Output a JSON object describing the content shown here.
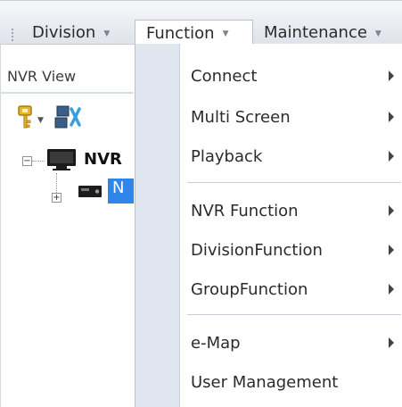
{
  "menubar": {
    "items": [
      {
        "label": "Division"
      },
      {
        "label": "Function"
      },
      {
        "label": "Maintenance"
      }
    ]
  },
  "panel": {
    "title": "NVR View",
    "tree": {
      "root_label": "NVR",
      "child_label": "N"
    }
  },
  "dropdown": {
    "items": [
      {
        "label": "Connect",
        "has_submenu": true
      },
      {
        "label": "Multi Screen",
        "has_submenu": true
      },
      {
        "label": "Playback",
        "has_submenu": true
      },
      {
        "label": "NVR Function",
        "has_submenu": true
      },
      {
        "label": "DivisionFunction",
        "has_submenu": true
      },
      {
        "label": "GroupFunction",
        "has_submenu": true
      },
      {
        "label": "e-Map",
        "has_submenu": true
      },
      {
        "label": "User Management",
        "has_submenu": false
      }
    ]
  },
  "colors": {
    "menu_gutter": "#dfe6ef",
    "tree_selection": "#2f86e8"
  },
  "icons": [
    "key-icon",
    "network-settings-icon",
    "monitor-icon",
    "device-icon",
    "expand-plus-icon",
    "collapse-minus-icon",
    "submenu-arrow-icon",
    "chevron-down-icon"
  ]
}
